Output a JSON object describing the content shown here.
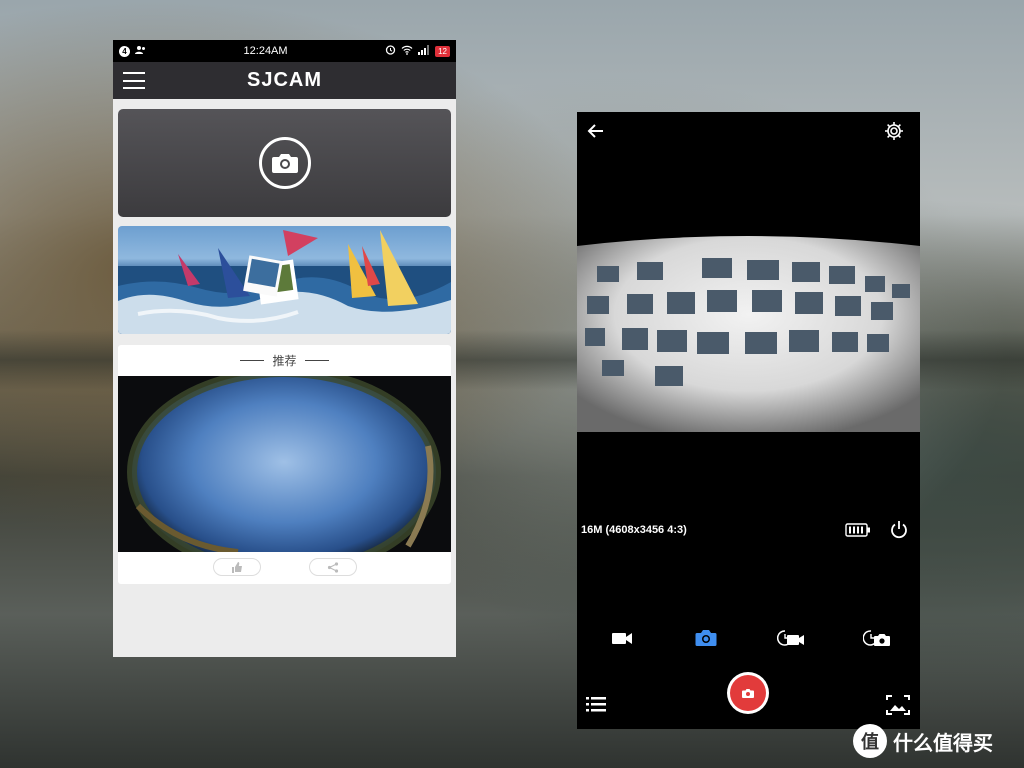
{
  "status_bar": {
    "time": "12:24AM",
    "notification_count": "4",
    "battery": "12"
  },
  "app": {
    "logo": "SJCAM"
  },
  "recommend": {
    "title": "推荐"
  },
  "camera": {
    "resolution": "16M (4608x3456 4:3)",
    "modes": [
      "video-icon",
      "photo-icon",
      "timelapse-video-icon",
      "timelapse-photo-icon"
    ],
    "active_mode": "photo-icon",
    "accent_color": "#3f8ef0",
    "shutter_color": "#e23b3b"
  },
  "watermark": {
    "text": "什么值得买",
    "logo_char": "值"
  }
}
